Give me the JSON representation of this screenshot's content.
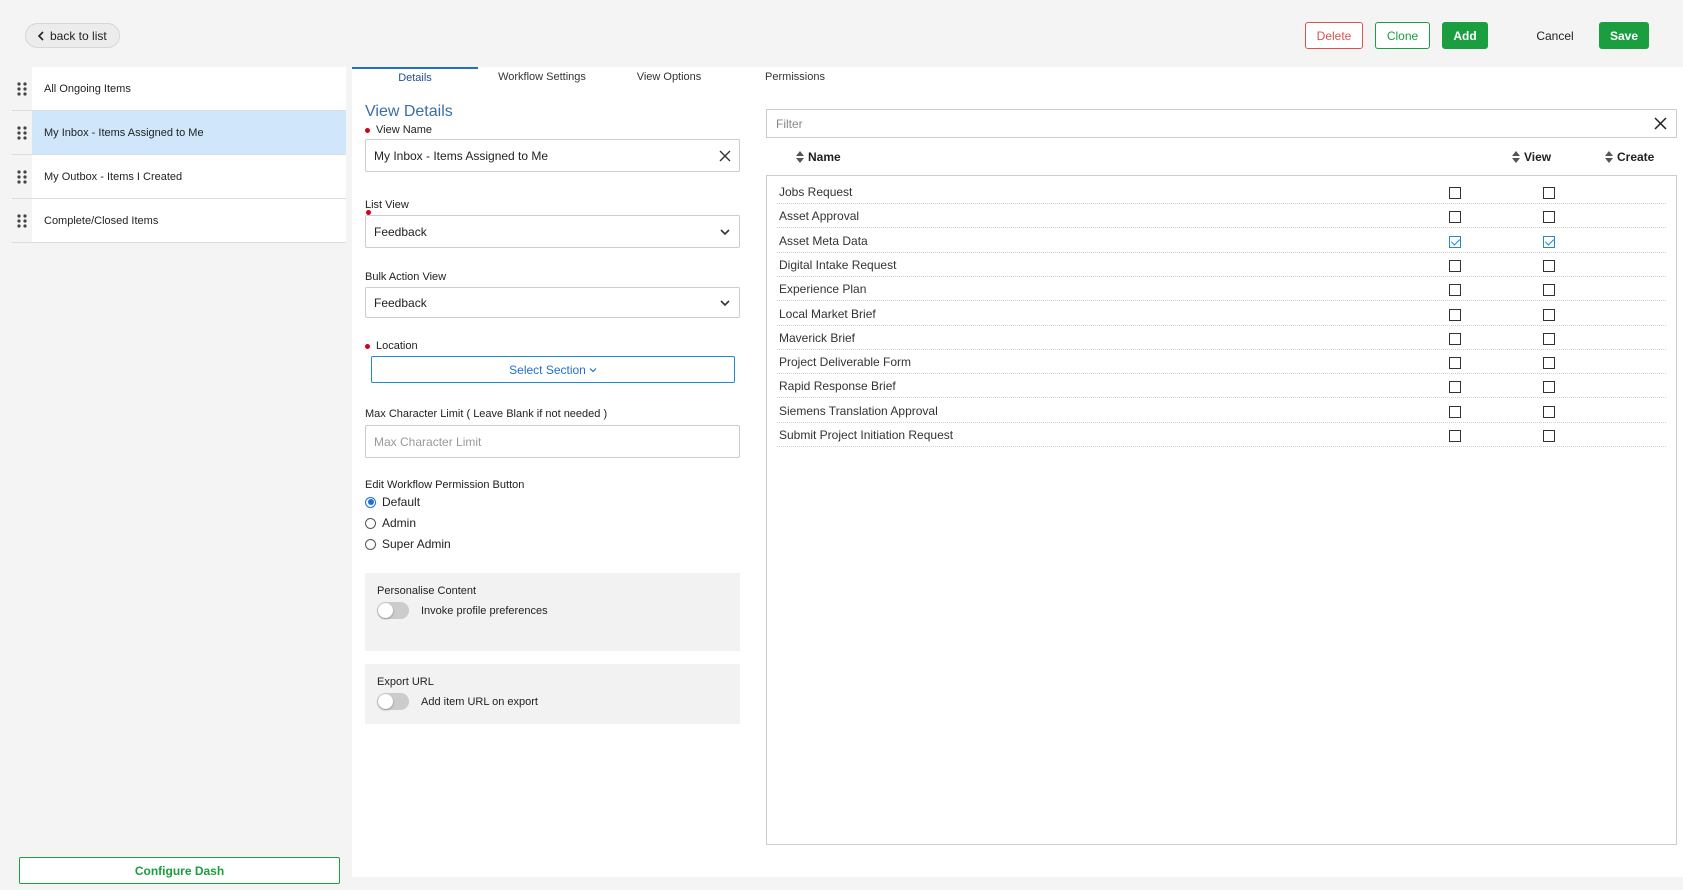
{
  "toolbar": {
    "back_label": "back to list",
    "delete_label": "Delete",
    "clone_label": "Clone",
    "add_label": "Add",
    "cancel_label": "Cancel",
    "save_label": "Save"
  },
  "sidebar": {
    "items": [
      {
        "label": "All Ongoing Items",
        "active": false
      },
      {
        "label": "My Inbox - Items Assigned to Me",
        "active": true
      },
      {
        "label": "My Outbox - Items I Created",
        "active": false
      },
      {
        "label": "Complete/Closed Items",
        "active": false
      }
    ],
    "configure_label": "Configure Dash"
  },
  "tabs": [
    {
      "label": "Details",
      "active": true
    },
    {
      "label": "Workflow Settings",
      "active": false
    },
    {
      "label": "View Options",
      "active": false
    },
    {
      "label": "Permissions",
      "active": false
    }
  ],
  "details": {
    "section_title": "View Details",
    "view_name_label": "View Name",
    "view_name_value": "My Inbox - Items Assigned to Me",
    "list_view_label": "List View",
    "list_view_value": "Feedback",
    "bulk_action_label": "Bulk Action View",
    "bulk_action_value": "Feedback",
    "location_label": "Location",
    "location_button": "Select Section",
    "max_char_label": "Max Character Limit ( Leave Blank if not needed )",
    "max_char_placeholder": "Max Character Limit",
    "edit_perm_label": "Edit Workflow Permission Button",
    "radio_options": [
      {
        "label": "Default",
        "selected": true
      },
      {
        "label": "Admin",
        "selected": false
      },
      {
        "label": "Super Admin",
        "selected": false
      }
    ],
    "personalise": {
      "title": "Personalise Content",
      "toggle_label": "Invoke profile preferences",
      "on": false
    },
    "export": {
      "title": "Export URL",
      "toggle_label": "Add item URL on export",
      "on": false
    }
  },
  "permissions": {
    "filter_placeholder": "Filter",
    "headers": {
      "name": "Name",
      "view": "View",
      "create": "Create"
    },
    "rows": [
      {
        "name": "Jobs Request",
        "view": false,
        "create": false
      },
      {
        "name": "Asset Approval",
        "view": false,
        "create": false
      },
      {
        "name": "Asset Meta Data",
        "view": true,
        "create": true
      },
      {
        "name": "Digital Intake Request",
        "view": false,
        "create": false
      },
      {
        "name": "Experience Plan",
        "view": false,
        "create": false
      },
      {
        "name": "Local Market Brief",
        "view": false,
        "create": false
      },
      {
        "name": "Maverick Brief",
        "view": false,
        "create": false
      },
      {
        "name": "Project Deliverable Form",
        "view": false,
        "create": false
      },
      {
        "name": "Rapid Response Brief",
        "view": false,
        "create": false
      },
      {
        "name": "Siemens Translation Approval",
        "view": false,
        "create": false
      },
      {
        "name": "Submit Project Initiation Request",
        "view": false,
        "create": false
      }
    ]
  },
  "colors": {
    "accent_green": "#1a9e3f",
    "danger_red": "#d9534f",
    "link_blue": "#1f6fd1",
    "active_row": "#cfe6fb"
  }
}
